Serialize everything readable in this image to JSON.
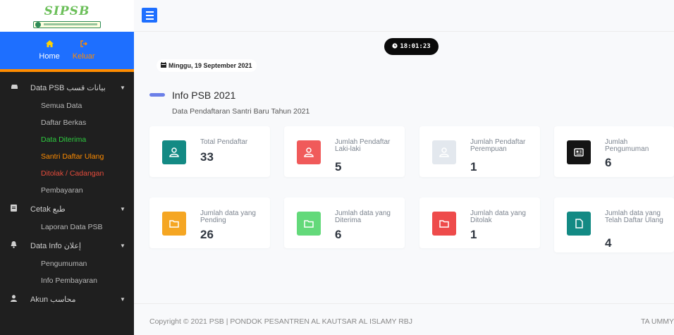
{
  "brand": {
    "logo_text": "SIPSB"
  },
  "user_panel": {
    "home_label": "Home",
    "logout_label": "Keluar"
  },
  "menu": {
    "data_psb": {
      "label": "Data PSB بيانات قسب",
      "items": [
        "Semua Data",
        "Daftar Berkas",
        "Data Diterima",
        "Santri Daftar Ulang",
        "Ditolak / Cadangan",
        "Pembayaran"
      ]
    },
    "cetak": {
      "label": "Cetak طبع",
      "items": [
        "Laporan Data PSB"
      ]
    },
    "data_info": {
      "label": "Data Info إعلان",
      "items": [
        "Pengumuman",
        "Info Pembayaran"
      ]
    },
    "akun": {
      "label": "Akun محاسب"
    }
  },
  "clock": {
    "time": "18:01:23"
  },
  "date": {
    "text": "Minggu, 19 September 2021"
  },
  "info": {
    "title": "Info PSB 2021",
    "subtitle": "Data Pendaftaran Santri Baru Tahun 2021"
  },
  "cards": [
    {
      "label": "Total Pendaftar",
      "value": "33",
      "color": "#138a84",
      "icon": "user-icon"
    },
    {
      "label": "Jumlah Pendaftar Laki-laki",
      "value": "5",
      "color": "#f05a5a",
      "icon": "user-icon"
    },
    {
      "label": "Jumlah Pendaftar Perempuan",
      "value": "1",
      "color": "#e3e8ee",
      "icon": "user-icon"
    },
    {
      "label": "Jumlah Pengumuman",
      "value": "6",
      "color": "#141414",
      "icon": "newspaper-icon"
    },
    {
      "label": "Jumlah data yang Pending",
      "value": "26",
      "color": "#f5a623",
      "icon": "folder-icon"
    },
    {
      "label": "Jumlah data yang Diterima",
      "value": "6",
      "color": "#63d97a",
      "icon": "folder-icon"
    },
    {
      "label": "Jumlah data yang Ditolak",
      "value": "1",
      "color": "#ee4b4b",
      "icon": "folder-icon"
    },
    {
      "label": "Jumlah data yang Telah Daftar Ulang",
      "value": "4",
      "color": "#138a84",
      "icon": "file-icon"
    }
  ],
  "footer": {
    "copyright": "Copyright © 2021 PSB | PONDOK PESANTREN AL KAUTSAR AL ISLAMY RBJ",
    "right": "TA UMMY"
  },
  "colors": {
    "sidebar_bg": "#1f1f1f",
    "user_panel_bg": "#1e6fff",
    "accent_orange": "#ff8c00",
    "menu_active_green": "#2ecc40",
    "menu_warning_orange": "#ff8c00",
    "menu_danger_red": "#e74c3c"
  }
}
